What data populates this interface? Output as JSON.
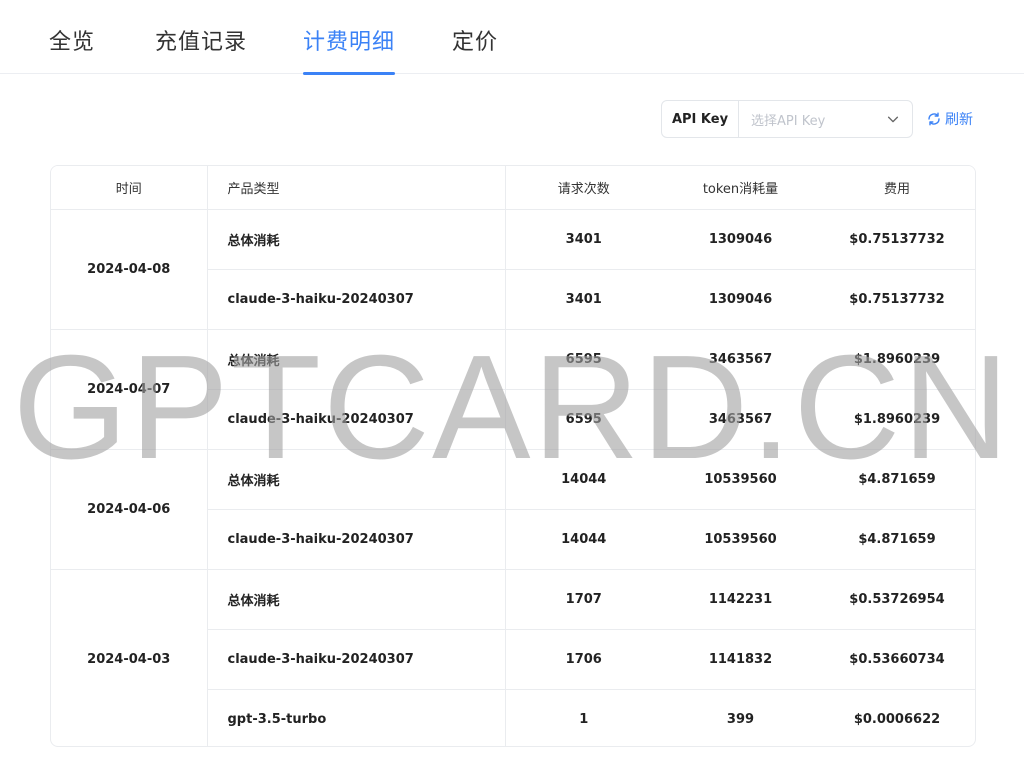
{
  "tabs": [
    {
      "label": "全览"
    },
    {
      "label": "充值记录"
    },
    {
      "label": "计费明细"
    },
    {
      "label": "定价"
    }
  ],
  "active_tab": 2,
  "filter": {
    "label": "API Key",
    "placeholder": "选择API Key"
  },
  "refresh_label": "刷新",
  "table": {
    "headers": {
      "date": "时间",
      "product": "产品类型",
      "requests": "请求次数",
      "tokens": "token消耗量",
      "fee": "费用"
    },
    "groups": [
      {
        "date": "2024-04-08",
        "rows": [
          {
            "product": "总体消耗",
            "requests": "3401",
            "tokens": "1309046",
            "fee": "$0.75137732"
          },
          {
            "product": "claude-3-haiku-20240307",
            "requests": "3401",
            "tokens": "1309046",
            "fee": "$0.75137732"
          }
        ]
      },
      {
        "date": "2024-04-07",
        "rows": [
          {
            "product": "总体消耗",
            "requests": "6595",
            "tokens": "3463567",
            "fee": "$1.8960239"
          },
          {
            "product": "claude-3-haiku-20240307",
            "requests": "6595",
            "tokens": "3463567",
            "fee": "$1.8960239"
          }
        ]
      },
      {
        "date": "2024-04-06",
        "rows": [
          {
            "product": "总体消耗",
            "requests": "14044",
            "tokens": "10539560",
            "fee": "$4.871659"
          },
          {
            "product": "claude-3-haiku-20240307",
            "requests": "14044",
            "tokens": "10539560",
            "fee": "$4.871659"
          }
        ]
      },
      {
        "date": "2024-04-03",
        "rows": [
          {
            "product": "总体消耗",
            "requests": "1707",
            "tokens": "1142231",
            "fee": "$0.53726954"
          },
          {
            "product": "claude-3-haiku-20240307",
            "requests": "1706",
            "tokens": "1141832",
            "fee": "$0.53660734"
          },
          {
            "product": "gpt-3.5-turbo",
            "requests": "1",
            "tokens": "399",
            "fee": "$0.0006622"
          }
        ]
      }
    ]
  },
  "watermark": "GPTCARD.CN",
  "colors": {
    "accent": "#3b82f6",
    "border": "#eaecef"
  }
}
